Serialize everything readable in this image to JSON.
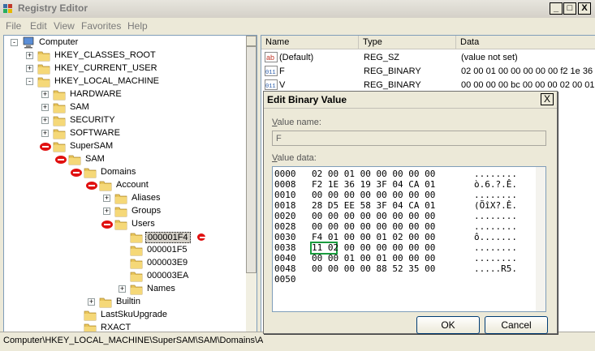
{
  "window": {
    "title": "Registry Editor",
    "minimize": "_",
    "maximize": "□",
    "close": "X"
  },
  "menu": [
    "File",
    "Edit",
    "View",
    "Favorites",
    "Help"
  ],
  "tree": [
    {
      "label": "Computer",
      "level": 0,
      "exp": "-",
      "icon": "computer"
    },
    {
      "label": "HKEY_CLASSES_ROOT",
      "level": 1,
      "exp": "+",
      "icon": "folder"
    },
    {
      "label": "HKEY_CURRENT_USER",
      "level": 1,
      "exp": "+",
      "icon": "folder"
    },
    {
      "label": "HKEY_LOCAL_MACHINE",
      "level": 1,
      "exp": "-",
      "icon": "folder"
    },
    {
      "label": "HARDWARE",
      "level": 2,
      "exp": "+",
      "icon": "folder"
    },
    {
      "label": "SAM",
      "level": 2,
      "exp": "+",
      "icon": "folder"
    },
    {
      "label": "SECURITY",
      "level": 2,
      "exp": "+",
      "icon": "folder"
    },
    {
      "label": "SOFTWARE",
      "level": 2,
      "exp": "+",
      "icon": "folder"
    },
    {
      "label": "SuperSAM",
      "level": 2,
      "exp": "red",
      "icon": "folder"
    },
    {
      "label": "SAM",
      "level": 3,
      "exp": "red",
      "icon": "folder"
    },
    {
      "label": "Domains",
      "level": 4,
      "exp": "red",
      "icon": "folder"
    },
    {
      "label": "Account",
      "level": 5,
      "exp": "red",
      "icon": "folder"
    },
    {
      "label": "Aliases",
      "level": 6,
      "exp": "+",
      "icon": "folder"
    },
    {
      "label": "Groups",
      "level": 6,
      "exp": "+",
      "icon": "folder"
    },
    {
      "label": "Users",
      "level": 6,
      "exp": "red",
      "icon": "folder"
    },
    {
      "label": "000001F4",
      "level": 7,
      "exp": "",
      "icon": "folder",
      "selected": true,
      "mark": true
    },
    {
      "label": "000001F5",
      "level": 7,
      "exp": "",
      "icon": "folder"
    },
    {
      "label": "000003E9",
      "level": 7,
      "exp": "",
      "icon": "folder"
    },
    {
      "label": "000003EA",
      "level": 7,
      "exp": "",
      "icon": "folder"
    },
    {
      "label": "Names",
      "level": 7,
      "exp": "+",
      "icon": "folder"
    },
    {
      "label": "Builtin",
      "level": 5,
      "exp": "+",
      "icon": "folder"
    },
    {
      "label": "LastSkuUpgrade",
      "level": 4,
      "exp": "",
      "icon": "folder"
    },
    {
      "label": "RXACT",
      "level": 4,
      "exp": "",
      "icon": "folder"
    }
  ],
  "list": {
    "columns": [
      "Name",
      "Type",
      "Data"
    ],
    "rows": [
      {
        "name": "(Default)",
        "type": "REG_SZ",
        "data": "(value not set)",
        "icon": "ab"
      },
      {
        "name": "F",
        "type": "REG_BINARY",
        "data": "02 00 01 00 00 00 00 00 f2 1e 36",
        "icon": "bin"
      },
      {
        "name": "V",
        "type": "REG_BINARY",
        "data": "00 00 00 00 bc 00 00 00 02 00 01",
        "icon": "bin"
      }
    ]
  },
  "statusbar": "Computer\\HKEY_LOCAL_MACHINE\\SuperSAM\\SAM\\Domains\\Accou",
  "dialog": {
    "title": "Edit Binary Value",
    "close": "X",
    "value_name_label_u": "V",
    "value_name_label_rest": "alue name:",
    "value_name": "F",
    "value_data_label_u": "V",
    "value_data_label_rest": "alue data:",
    "hex_rows": [
      {
        "off": "0000",
        "bytes": "02 00 01 00 00 00 00 00",
        "ascii": "........"
      },
      {
        "off": "0008",
        "bytes": "F2 1E 36 19 3F 04 CA 01",
        "ascii": "ò.6.?.Ê."
      },
      {
        "off": "0010",
        "bytes": "00 00 00 00 00 00 00 00",
        "ascii": "........"
      },
      {
        "off": "0018",
        "bytes": "28 D5 EE 58 3F 04 CA 01",
        "ascii": "(ÕîX?.Ê."
      },
      {
        "off": "0020",
        "bytes": "00 00 00 00 00 00 00 00",
        "ascii": "........"
      },
      {
        "off": "0028",
        "bytes": "00 00 00 00 00 00 00 00",
        "ascii": "........"
      },
      {
        "off": "0030",
        "bytes": "F4 01 00 00 01 02 00 00",
        "ascii": "ô......."
      },
      {
        "off": "0038",
        "bytes": "11 02 00 00 00 00 00 00",
        "ascii": "........"
      },
      {
        "off": "0040",
        "bytes": "00 00 01 00 01 00 00 00",
        "ascii": "........"
      },
      {
        "off": "0048",
        "bytes": "00 00 00 00 88 52 35 00",
        "ascii": ".....R5."
      },
      {
        "off": "0050",
        "bytes": "",
        "ascii": ""
      }
    ],
    "ok": "OK",
    "cancel": "Cancel"
  }
}
